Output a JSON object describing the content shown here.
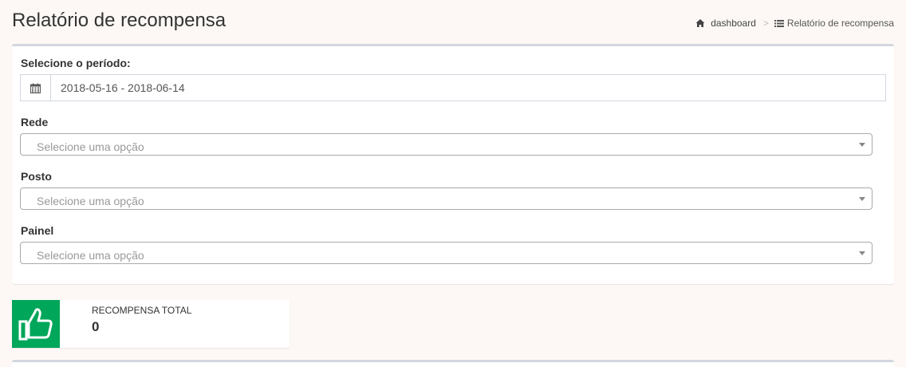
{
  "header": {
    "title": "Relatório de recompensa",
    "breadcrumb": {
      "home_icon": "home-icon",
      "home_label": "dashboard",
      "separator": ">",
      "current_icon": "list-icon",
      "current_label": "Relatório de recompensa"
    }
  },
  "filters": {
    "period_label": "Selecione o período:",
    "period_icon": "calendar-icon",
    "period_value": "2018-05-16 - 2018-06-14",
    "rede": {
      "label": "Rede",
      "placeholder": "Selecione uma opção"
    },
    "posto": {
      "label": "Posto",
      "placeholder": "Selecione uma opção"
    },
    "painel": {
      "label": "Painel",
      "placeholder": "Selecione uma opção"
    }
  },
  "summary": {
    "icon": "thumbs-up-icon",
    "icon_bg": "#00a65a",
    "label": "RECOMPENSA TOTAL",
    "value": "0"
  }
}
